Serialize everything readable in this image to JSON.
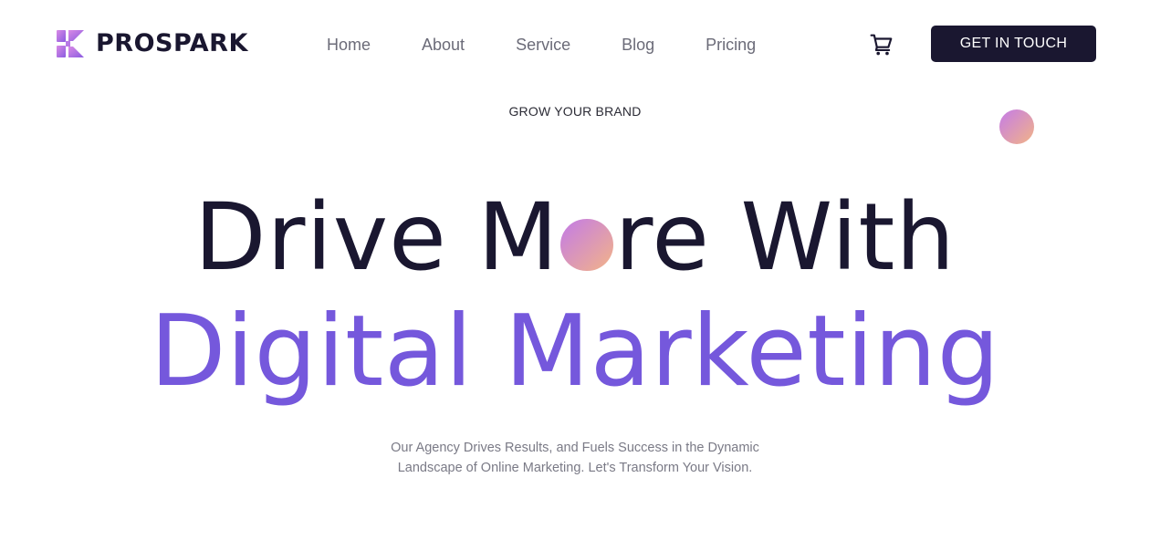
{
  "brand": {
    "name": "PROSPARK",
    "logo_icon": "prospark-logo-icon",
    "colors": {
      "dark": "#1a1730",
      "accent": "#7558dc",
      "gradient_start": "#c27ae8",
      "gradient_end": "#f3b487"
    }
  },
  "nav": {
    "items": [
      {
        "label": "Home"
      },
      {
        "label": "About"
      },
      {
        "label": "Service"
      },
      {
        "label": "Blog"
      },
      {
        "label": "Pricing"
      }
    ],
    "cart_icon": "cart-icon",
    "cta_label": "GET IN TOUCH"
  },
  "hero": {
    "eyebrow": "GROW YOUR BRAND",
    "headline_line1_part1": "Drive M",
    "headline_line1_part2": "re With",
    "headline_line2": "Digital Marketing",
    "subtitle_line1": "Our Agency Drives Results, and Fuels Success in the Dynamic",
    "subtitle_line2": "Landscape of Online Marketing. Let's Transform Your Vision."
  }
}
